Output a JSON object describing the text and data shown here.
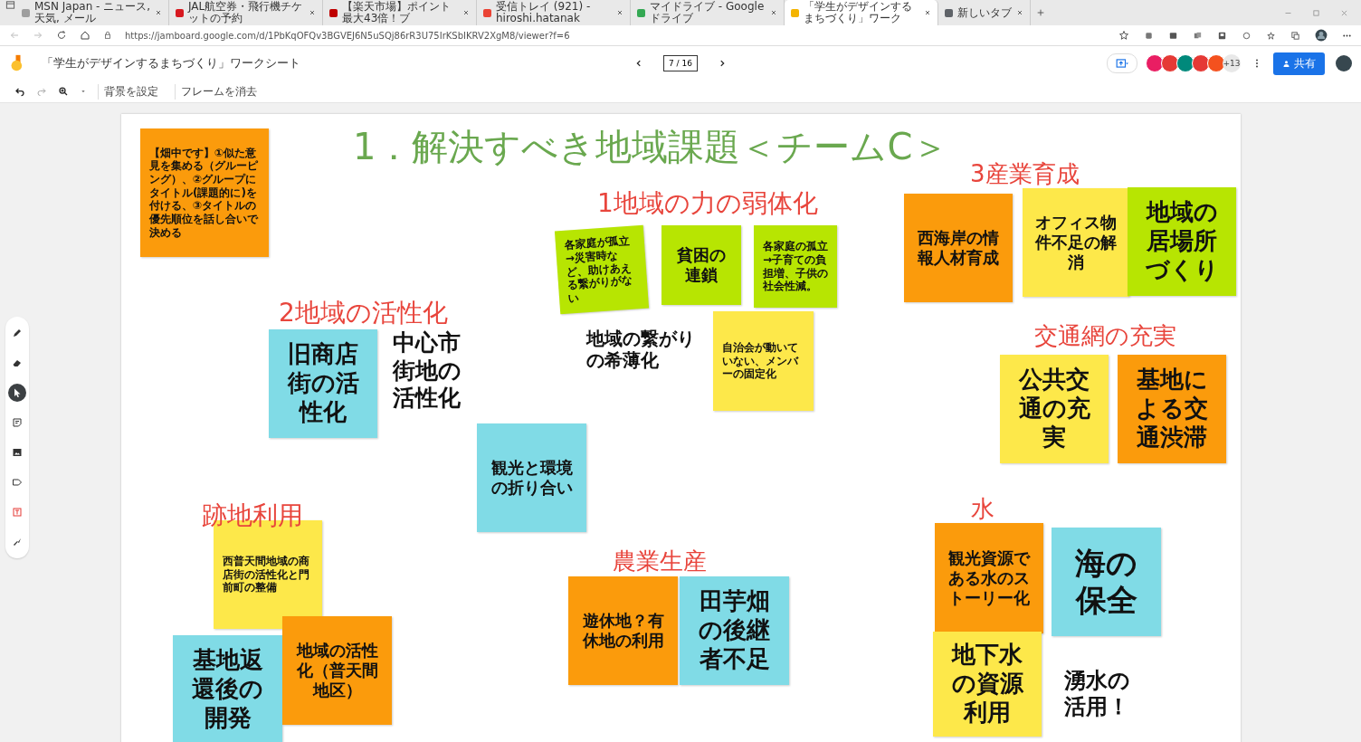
{
  "browser": {
    "tabs": [
      {
        "title": "MSN Japan - ニュース, 天気, メール",
        "selected": false,
        "color": "#9e9e9e"
      },
      {
        "title": "JAL航空券・飛行機チケットの予約",
        "selected": false,
        "color": "#d71920"
      },
      {
        "title": "【楽天市場】ポイント最大43倍！ブ",
        "selected": false,
        "color": "#bf0000"
      },
      {
        "title": "受信トレイ (921) - hiroshi.hatanak",
        "selected": false,
        "color": "#ea4335"
      },
      {
        "title": "マイドライブ - Google ドライブ",
        "selected": false,
        "color": "#34a853"
      },
      {
        "title": "「学生がデザインするまちづくり」ワーク",
        "selected": true,
        "color": "#f4b400"
      },
      {
        "title": "新しいタブ",
        "selected": false,
        "color": "#5f6368"
      }
    ],
    "url": "https://jamboard.google.com/d/1PbKqOFQv3BGVEJ6N5uSQj86rR3U75IrKSbIKRV2XgM8/viewer?f=6"
  },
  "app": {
    "title": "「学生がデザインするまちづくり」ワークシート",
    "page_indicator": "7 / 16",
    "collaborators": [
      {
        "color": "#e91e63"
      },
      {
        "color": "#e53935"
      },
      {
        "color": "#00897b"
      },
      {
        "color": "#e53935"
      },
      {
        "color": "#f4511e"
      }
    ],
    "more_collaborators": "+13",
    "share": "共有"
  },
  "toolbar": [
    "背景を設定",
    "フレームを消去"
  ],
  "tools": [
    {
      "kind": "pen",
      "selected": false
    },
    {
      "kind": "eraser",
      "selected": false
    },
    {
      "kind": "select",
      "selected": true
    },
    {
      "kind": "note",
      "selected": false
    },
    {
      "kind": "image",
      "selected": false
    },
    {
      "kind": "shape",
      "selected": false
    },
    {
      "kind": "textbox",
      "selected": false
    },
    {
      "kind": "laser",
      "selected": false
    }
  ],
  "board": {
    "items": [
      {
        "kind": "note",
        "text": "【畑中です】①似た意見を集める（グルーピング）、②グループにタイトル(課題的に)を付ける、③タイトルの優先順位を話し合いで決める",
        "color": "#fb9b0c"
      },
      {
        "kind": "heading",
        "text": "1．解決すべき地域課題＜チームC＞",
        "color": "#6aa84f"
      },
      {
        "kind": "heading",
        "text": "1地域の力の弱体化",
        "color": "#e8453c"
      },
      {
        "kind": "note",
        "text": "各家庭が孤立→災害時など、助けあえる繋がりがない",
        "color": "#b7e502"
      },
      {
        "kind": "note",
        "text": "貧困の連鎖",
        "color": "#b7e502"
      },
      {
        "kind": "note",
        "text": "各家庭の孤立→子育ての負担増、子供の社会性減。",
        "color": "#b7e502"
      },
      {
        "kind": "heading",
        "text": "3産業育成",
        "color": "#e8453c"
      },
      {
        "kind": "note",
        "text": "西海岸の情報人材育成",
        "color": "#fb9b0c"
      },
      {
        "kind": "note",
        "text": "オフィス物件不足の解消",
        "color": "#fde84a"
      },
      {
        "kind": "note",
        "text": "地域の居場所づくり",
        "color": "#b7e502"
      },
      {
        "kind": "heading",
        "text": "2地域の活性化",
        "color": "#e8453c"
      },
      {
        "kind": "note",
        "text": "旧商店街の活性化",
        "color": "#80dbe6"
      },
      {
        "kind": "text",
        "text": "中心市街地の活性化"
      },
      {
        "kind": "text",
        "text": "地域の繋がりの希薄化"
      },
      {
        "kind": "note",
        "text": "自治会が動いていない、メンバーの固定化",
        "color": "#fde84a"
      },
      {
        "kind": "heading",
        "text": "交通網の充実",
        "color": "#e8453c"
      },
      {
        "kind": "note",
        "text": "公共交通の充実",
        "color": "#fde84a"
      },
      {
        "kind": "note",
        "text": "基地による交通渋滞",
        "color": "#fb9b0c"
      },
      {
        "kind": "note",
        "text": "観光と環境の折り合い",
        "color": "#80dbe6"
      },
      {
        "kind": "heading",
        "text": "跡地利用",
        "color": "#e8453c"
      },
      {
        "kind": "note",
        "text": "西普天間地域の商店街の活性化と門前町の整備",
        "color": "#fde84a"
      },
      {
        "kind": "note",
        "text": "基地返還後の開発",
        "color": "#80dbe6"
      },
      {
        "kind": "note",
        "text": "地域の活性化（普天間地区）",
        "color": "#fb9b0c"
      },
      {
        "kind": "heading",
        "text": "農業生産",
        "color": "#e8453c"
      },
      {
        "kind": "note",
        "text": "遊休地？有休地の利用",
        "color": "#fb9b0c"
      },
      {
        "kind": "note",
        "text": "田芋畑の後継者不足",
        "color": "#80dbe6"
      },
      {
        "kind": "heading",
        "text": "水",
        "color": "#e8453c"
      },
      {
        "kind": "note",
        "text": "観光資源である水のストーリー化",
        "color": "#fb9b0c"
      },
      {
        "kind": "note",
        "text": "海の保全",
        "color": "#80dbe6"
      },
      {
        "kind": "note",
        "text": "地下水の資源利用",
        "color": "#fde84a"
      },
      {
        "kind": "text",
        "text": "湧水の活用！"
      }
    ]
  }
}
